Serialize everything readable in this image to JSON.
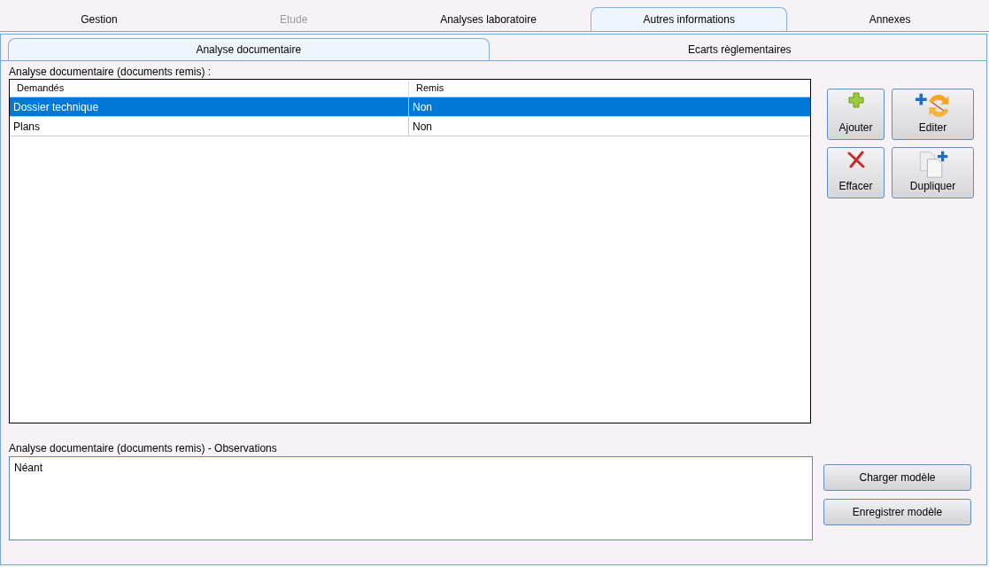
{
  "tabs": [
    {
      "label": "Gestion",
      "selected": false,
      "disabled": false
    },
    {
      "label": "Etude",
      "selected": false,
      "disabled": true
    },
    {
      "label": "Analyses laboratoire",
      "selected": false,
      "disabled": false
    },
    {
      "label": "Autres informations",
      "selected": true,
      "disabled": false
    },
    {
      "label": "Annexes",
      "selected": false,
      "disabled": false
    }
  ],
  "subtabs": [
    {
      "label": "Analyse documentaire",
      "selected": true
    },
    {
      "label": "Ecarts règlementaires",
      "selected": false
    }
  ],
  "table": {
    "title": "Analyse documentaire (documents remis) :",
    "columns": [
      "Demandés",
      "Remis"
    ],
    "rows": [
      {
        "cells": [
          "Dossier technique",
          "Non"
        ],
        "selected": true
      },
      {
        "cells": [
          "Plans",
          "Non"
        ],
        "selected": false
      }
    ]
  },
  "actions": [
    {
      "label": "Ajouter",
      "kind": "add"
    },
    {
      "label": "Editer",
      "kind": "edit"
    },
    {
      "label": "Effacer",
      "kind": "delete"
    },
    {
      "label": "Dupliquer",
      "kind": "duplicate"
    }
  ],
  "observations": {
    "title": "Analyse documentaire (documents remis) - Observations",
    "value": "Néant"
  },
  "model_buttons": [
    "Charger modèle",
    "Enregistrer modèle"
  ]
}
